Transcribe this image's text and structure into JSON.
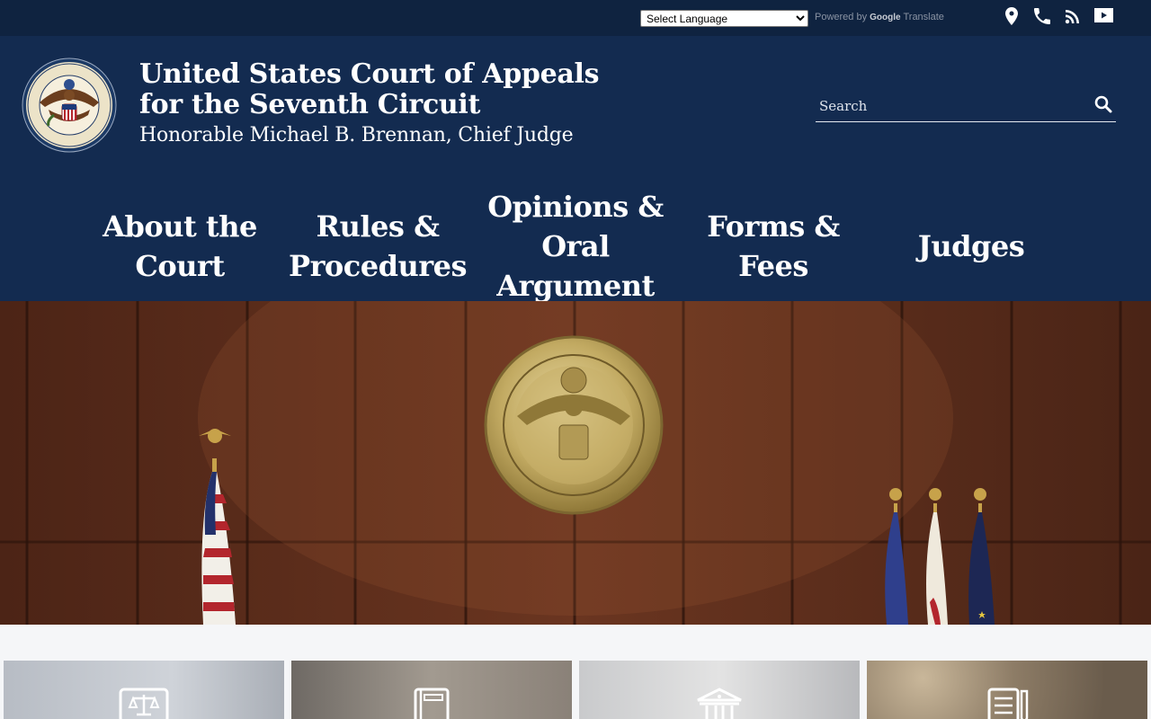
{
  "topbar": {
    "language_select": {
      "selected": "Select Language",
      "options": [
        "Select Language"
      ]
    },
    "powered_by": "Powered by",
    "google": "Google",
    "translate": "Translate",
    "icons": [
      "location-icon",
      "phone-icon",
      "rss-icon",
      "youtube-icon"
    ]
  },
  "header": {
    "title_line1": "United States Court of Appeals",
    "title_line2": "for the Seventh Circuit",
    "subtitle": "Honorable Michael B. Brennan, Chief Judge",
    "search_placeholder": "Search"
  },
  "nav": {
    "items": [
      {
        "label": "About the Court"
      },
      {
        "label": "Rules & Procedures"
      },
      {
        "label": "Opinions & Oral Argument"
      },
      {
        "label": "Forms & Fees"
      },
      {
        "label": "Judges"
      }
    ]
  },
  "colors": {
    "topbar": "#0f2340",
    "header": "#132b50",
    "accent_text": "#ffffff",
    "wood": "#5a2f1d"
  },
  "cards": {
    "icons": [
      "scales-of-justice-icon",
      "book-icon",
      "courthouse-icon",
      "document-pen-icon"
    ]
  }
}
